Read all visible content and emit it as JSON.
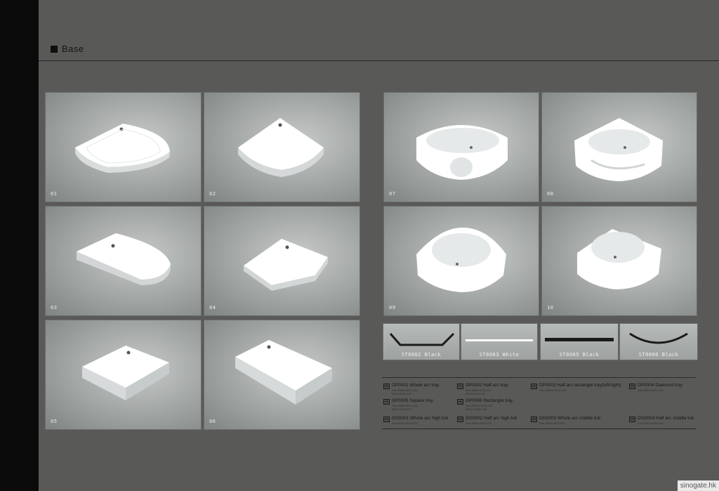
{
  "header": {
    "title": "Base"
  },
  "tiles": [
    {
      "num": "01",
      "shape": "quarter-tray"
    },
    {
      "num": "02",
      "shape": "half-arc-tray"
    },
    {
      "num": "03",
      "shape": "rect-arc-tray"
    },
    {
      "num": "04",
      "shape": "diamond-tray"
    },
    {
      "num": "05",
      "shape": "square-tray"
    },
    {
      "num": "06",
      "shape": "rect-tray"
    },
    {
      "num": "07",
      "shape": "whole-arc-high-tub"
    },
    {
      "num": "08",
      "shape": "half-arc-high-tub"
    },
    {
      "num": "09",
      "shape": "whole-arc-middle-tub"
    },
    {
      "num": "10",
      "shape": "half-arc-middle-tub"
    }
  ],
  "strips": [
    {
      "label": "ST0002 Black"
    },
    {
      "label": "ST0003 White"
    },
    {
      "label": "ST0005 Black"
    },
    {
      "label": "ST0006 Black"
    }
  ],
  "legend": [
    {
      "code": "DP0001   Whole arc tray",
      "size": "Size:Ø800×800×140\nØ900×900×140"
    },
    {
      "code": "DP0002   Half arc tray",
      "size": "Size:Ø800×800×140\nØ900×900×140"
    },
    {
      "code": "DP0003   Half arc rectangle tray(left/right)",
      "size": "Size:Ø800×1200×140"
    },
    {
      "code": "DP0004   Diamond tray",
      "size": "Size:Ø900×900×140"
    },
    {
      "code": "DP0005   Square tray",
      "size": "Size:Ø800×800×140\nØ900×900×140"
    },
    {
      "code": "DP0006   Rectangle tray",
      "size": "Size:Ø800×1000×140\nØ800×1200×140"
    },
    {
      "code": "DG0001   Whole arc high tub",
      "size": "Size:Ø900×900×470"
    },
    {
      "code": "DG0002   Half arc high tub",
      "size": "Size:Ø900×900×470"
    },
    {
      "code": "DG0003   Whole arc middle tub",
      "size": "Size:Ø900×900×300"
    },
    {
      "code": "DG0004   Half arc middle tub",
      "size": "Size:Ø900×900×300"
    }
  ],
  "watermark": "sinogate.hk"
}
